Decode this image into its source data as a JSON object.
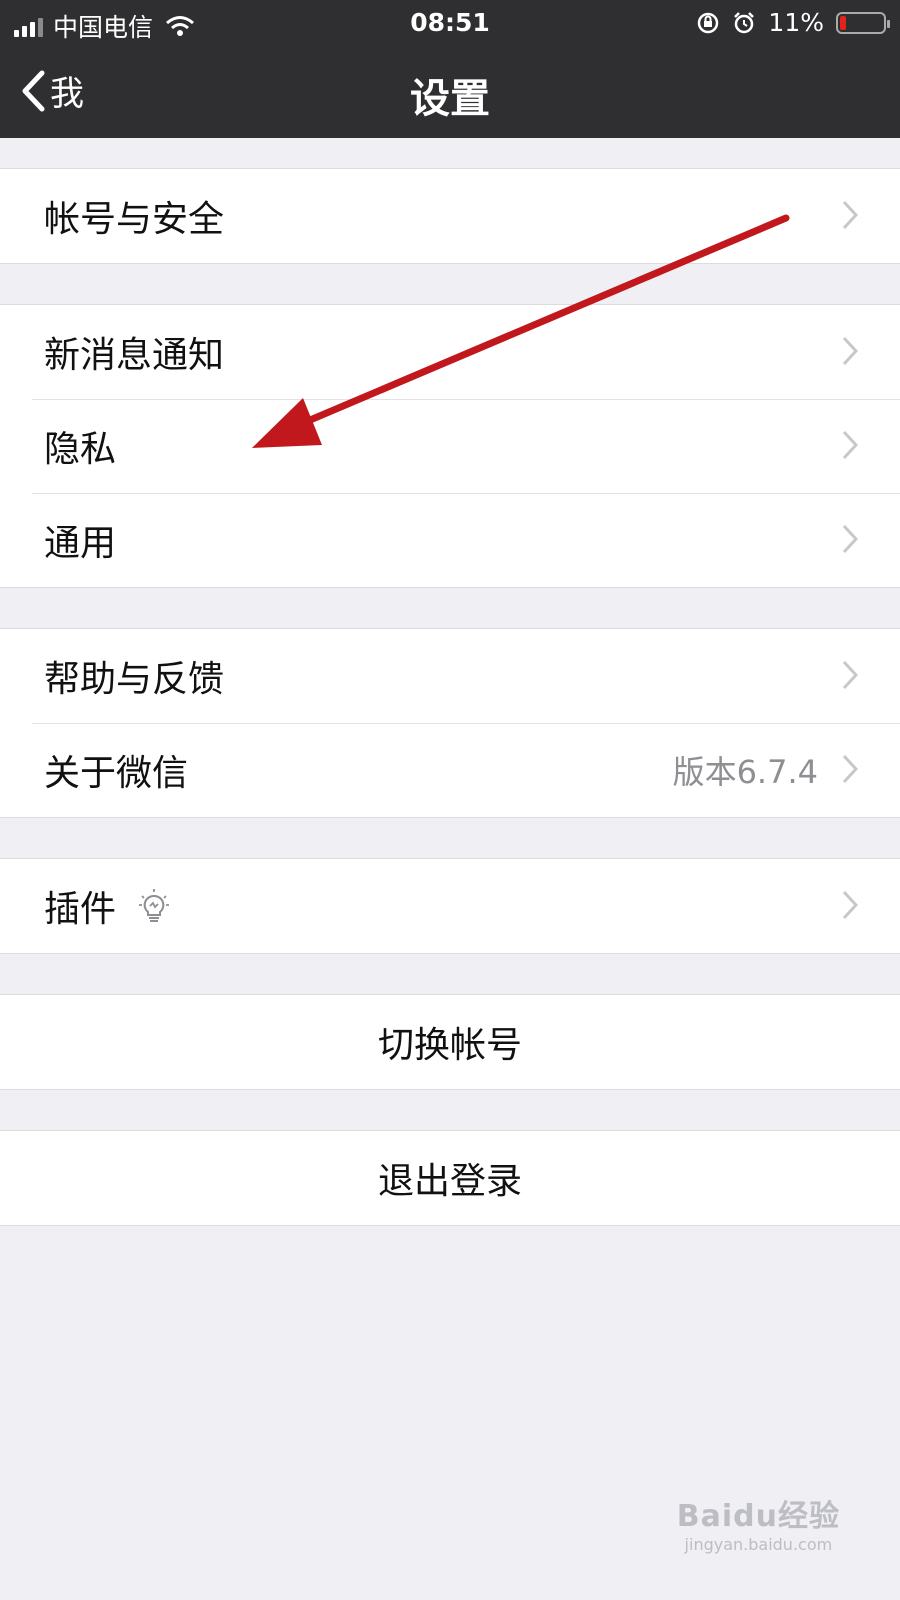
{
  "status_bar": {
    "carrier": "中国电信",
    "time": "08:51",
    "battery": "11%",
    "battery_level": 0.11
  },
  "nav": {
    "back_label": "我",
    "title": "设置"
  },
  "groups": [
    {
      "items": [
        {
          "label": "帐号与安全"
        }
      ]
    },
    {
      "items": [
        {
          "label": "新消息通知"
        },
        {
          "label": "隐私"
        },
        {
          "label": "通用"
        }
      ]
    },
    {
      "items": [
        {
          "label": "帮助与反馈"
        },
        {
          "label": "关于微信",
          "value": "版本6.7.4"
        }
      ]
    },
    {
      "items": [
        {
          "label": "插件",
          "icon": "lightbulb-icon"
        }
      ]
    }
  ],
  "actions": {
    "switch_account": "切换帐号",
    "logout": "退出登录"
  },
  "annotation": {
    "arrow_color": "#c0181c"
  },
  "watermark": {
    "brand": "Baidu经验",
    "url": "jingyan.baidu.com"
  }
}
